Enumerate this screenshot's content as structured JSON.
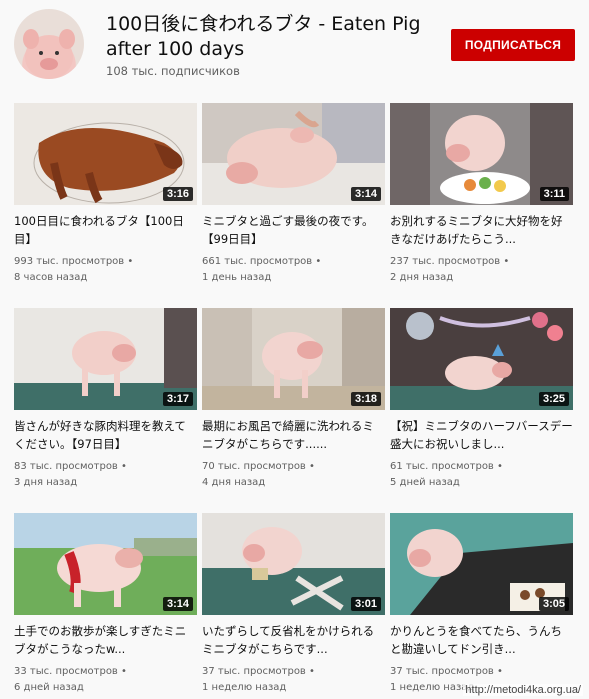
{
  "channel": {
    "title": "100日後に食われるブタ - Eaten Pig after 100 days",
    "subscribers": "108 тыс. подписчиков",
    "subscribe_label": "ПОДПИСАТЬСЯ"
  },
  "videos": [
    {
      "title": "100日目に食われるブタ【100日目】",
      "views": "993 тыс. просмотров •",
      "age": "8 часов назад",
      "duration": "3:16"
    },
    {
      "title": "ミニブタと過ごす最後の夜です。【99日目】",
      "views": "661 тыс. просмотров •",
      "age": "1 день назад",
      "duration": "3:14"
    },
    {
      "title": "お別れするミニブタに大好物を好きなだけあげたらこう...",
      "views": "237 тыс. просмотров •",
      "age": "2 дня назад",
      "duration": "3:11"
    },
    {
      "title": "皆さんが好きな豚肉料理を教えてください。【97日目】",
      "views": "83 тыс. просмотров •",
      "age": "3 дня назад",
      "duration": "3:17"
    },
    {
      "title": "最期にお風呂で綺麗に洗われるミニブタがこちらです......",
      "views": "70 тыс. просмотров •",
      "age": "4 дня назад",
      "duration": "3:18"
    },
    {
      "title": "【祝】ミニブタのハーフバースデー盛大にお祝いしまし...",
      "views": "61 тыс. просмотров •",
      "age": "5 дней назад",
      "duration": "3:25"
    },
    {
      "title": "土手でのお散歩が楽しすぎたミニブタがこうなったw...",
      "views": "33 тыс. просмотров •",
      "age": "6 дней назад",
      "duration": "3:14"
    },
    {
      "title": "いたずらして反省札をかけられるミニブタがこちらです...",
      "views": "37 тыс. просмотров •",
      "age": "1 неделю назад",
      "duration": "3:01"
    },
    {
      "title": "かりんとうを食べてたら、うんちと勘違いしてドン引き...",
      "views": "37 тыс. просмотров •",
      "age": "1 неделю назад",
      "duration": "3:05"
    }
  ],
  "watermark": "http://metodi4ka.org.ua/"
}
